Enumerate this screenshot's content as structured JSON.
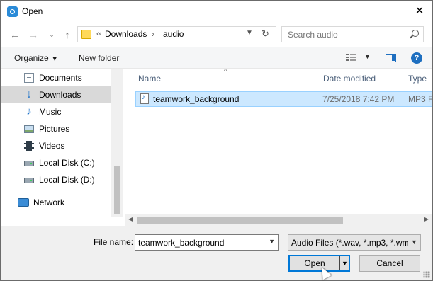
{
  "window": {
    "title": "Open",
    "icon": "open-dialog-icon"
  },
  "address": {
    "overflow": "‹‹",
    "crumbs": [
      "Downloads",
      "audio"
    ],
    "separator": "›"
  },
  "search": {
    "placeholder": "Search audio"
  },
  "toolbar": {
    "organize": "Organize",
    "new_folder": "New folder"
  },
  "nav": {
    "items": [
      {
        "label": "Documents",
        "icon": "documents-icon"
      },
      {
        "label": "Downloads",
        "icon": "downloads-icon",
        "selected": true
      },
      {
        "label": "Music",
        "icon": "music-icon"
      },
      {
        "label": "Pictures",
        "icon": "pictures-icon"
      },
      {
        "label": "Videos",
        "icon": "videos-icon"
      },
      {
        "label": "Local Disk (C:)",
        "icon": "drive-icon"
      },
      {
        "label": "Local Disk (D:)",
        "icon": "drive-icon"
      },
      {
        "label": "Network",
        "icon": "network-icon"
      }
    ]
  },
  "columns": {
    "name": "Name",
    "date": "Date modified",
    "type": "Type"
  },
  "files": [
    {
      "name": "teamwork_background",
      "date": "7/25/2018 7:42 PM",
      "type": "MP3 Fo",
      "selected": true
    }
  ],
  "bottom": {
    "file_name_label": "File name:",
    "file_name_value": "teamwork_background",
    "file_type_value": "Audio Files (*.wav, *.mp3, *.wm",
    "open_label": "Open",
    "cancel_label": "Cancel"
  },
  "colors": {
    "accent": "#0078d7",
    "selection": "#cce8ff",
    "nav_selected": "#d9d9d9"
  }
}
